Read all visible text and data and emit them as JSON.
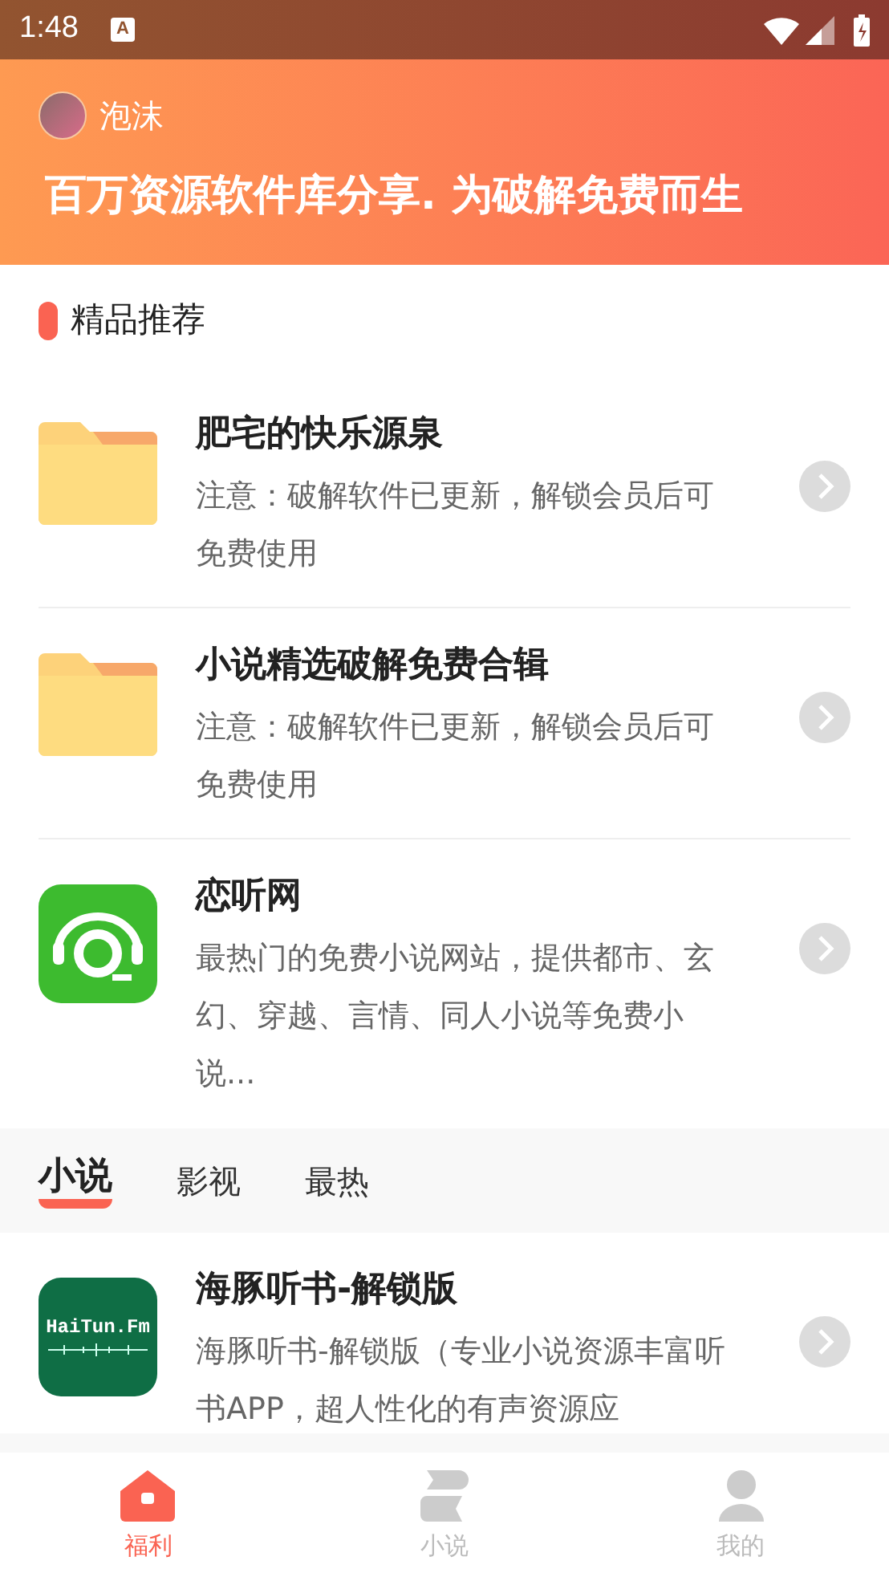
{
  "status_bar": {
    "time": "1:48",
    "notification_glyph": "A"
  },
  "header": {
    "username": "泡沫",
    "slogan": "百万资源软件库分享. 为破解免费而生"
  },
  "section": {
    "title": "精品推荐"
  },
  "featured": [
    {
      "kind": "folder",
      "title": "肥宅的快乐源泉",
      "description": "注意：破解软件已更新，解锁会员后可免费使用"
    },
    {
      "kind": "folder",
      "title": "小说精选破解免费合辑",
      "description": "注意：破解软件已更新，解锁会员后可免费使用"
    },
    {
      "kind": "headphones-app",
      "title": "恋听网",
      "description": "最热门的免费小说网站，提供都市、玄幻、穿越、言情、同人小说等免费小说..."
    }
  ],
  "tabs": [
    {
      "label": "小说",
      "selected": true
    },
    {
      "label": "影视",
      "selected": false
    },
    {
      "label": "最热",
      "selected": false
    }
  ],
  "list": [
    {
      "kind": "haitun-app",
      "logo_text": "HaiTun.Fm",
      "title": "海豚听书-解锁版",
      "description": "海豚听书-解锁版（专业小说资源丰富听书APP，超人性化的有声资源应"
    }
  ],
  "bottom_nav": [
    {
      "label": "福利",
      "kind": "home",
      "selected": true
    },
    {
      "label": "小说",
      "kind": "books",
      "selected": false
    },
    {
      "label": "我的",
      "kind": "person",
      "selected": false
    }
  ]
}
